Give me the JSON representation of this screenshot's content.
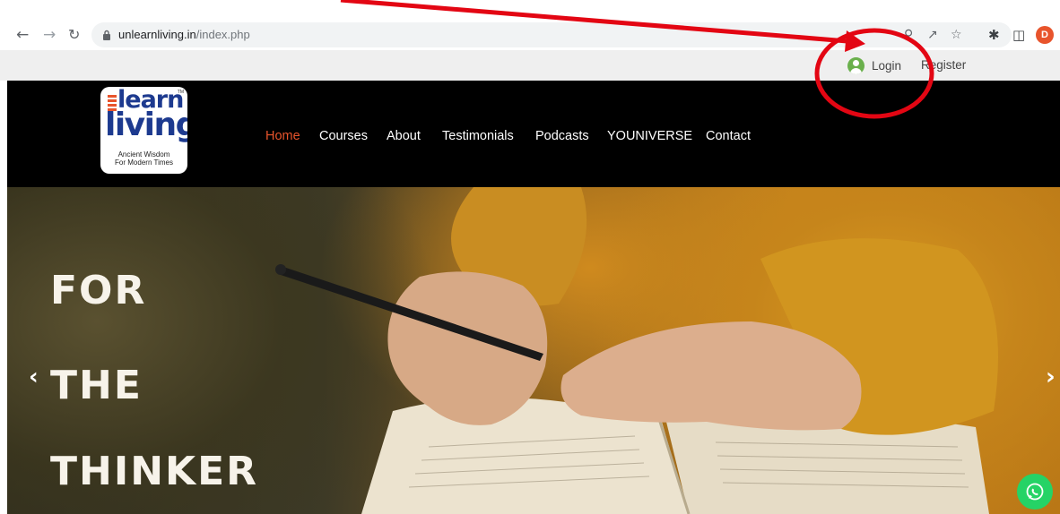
{
  "browser": {
    "back_icon": "arrow-left-icon",
    "forward_icon": "arrow-right-icon",
    "reload_icon": "reload-icon",
    "url_host": "unlearnliving.in",
    "url_path": "/index.php",
    "profile_initial": "D"
  },
  "top_bar": {
    "login_label": "Login",
    "register_label": "Register"
  },
  "logo": {
    "word_1": "learn",
    "word_2": "living",
    "tagline_1": "Ancient Wisdom",
    "tagline_2": "For Modern Times",
    "trademark": "TM"
  },
  "nav": {
    "items": [
      {
        "label": "Home",
        "active": true
      },
      {
        "label": "Courses"
      },
      {
        "label": "About"
      },
      {
        "label": "Testimonials"
      },
      {
        "label": "Podcasts"
      },
      {
        "label": "YOUNIVERSE"
      },
      {
        "label": "Contact"
      }
    ]
  },
  "hero": {
    "line_1": "FOR",
    "line_2": "THE",
    "line_3": "THINKER"
  },
  "colors": {
    "accent": "#e8542c",
    "header_bg": "#000000",
    "annotation": "#e30613",
    "whatsapp": "#25d366"
  }
}
